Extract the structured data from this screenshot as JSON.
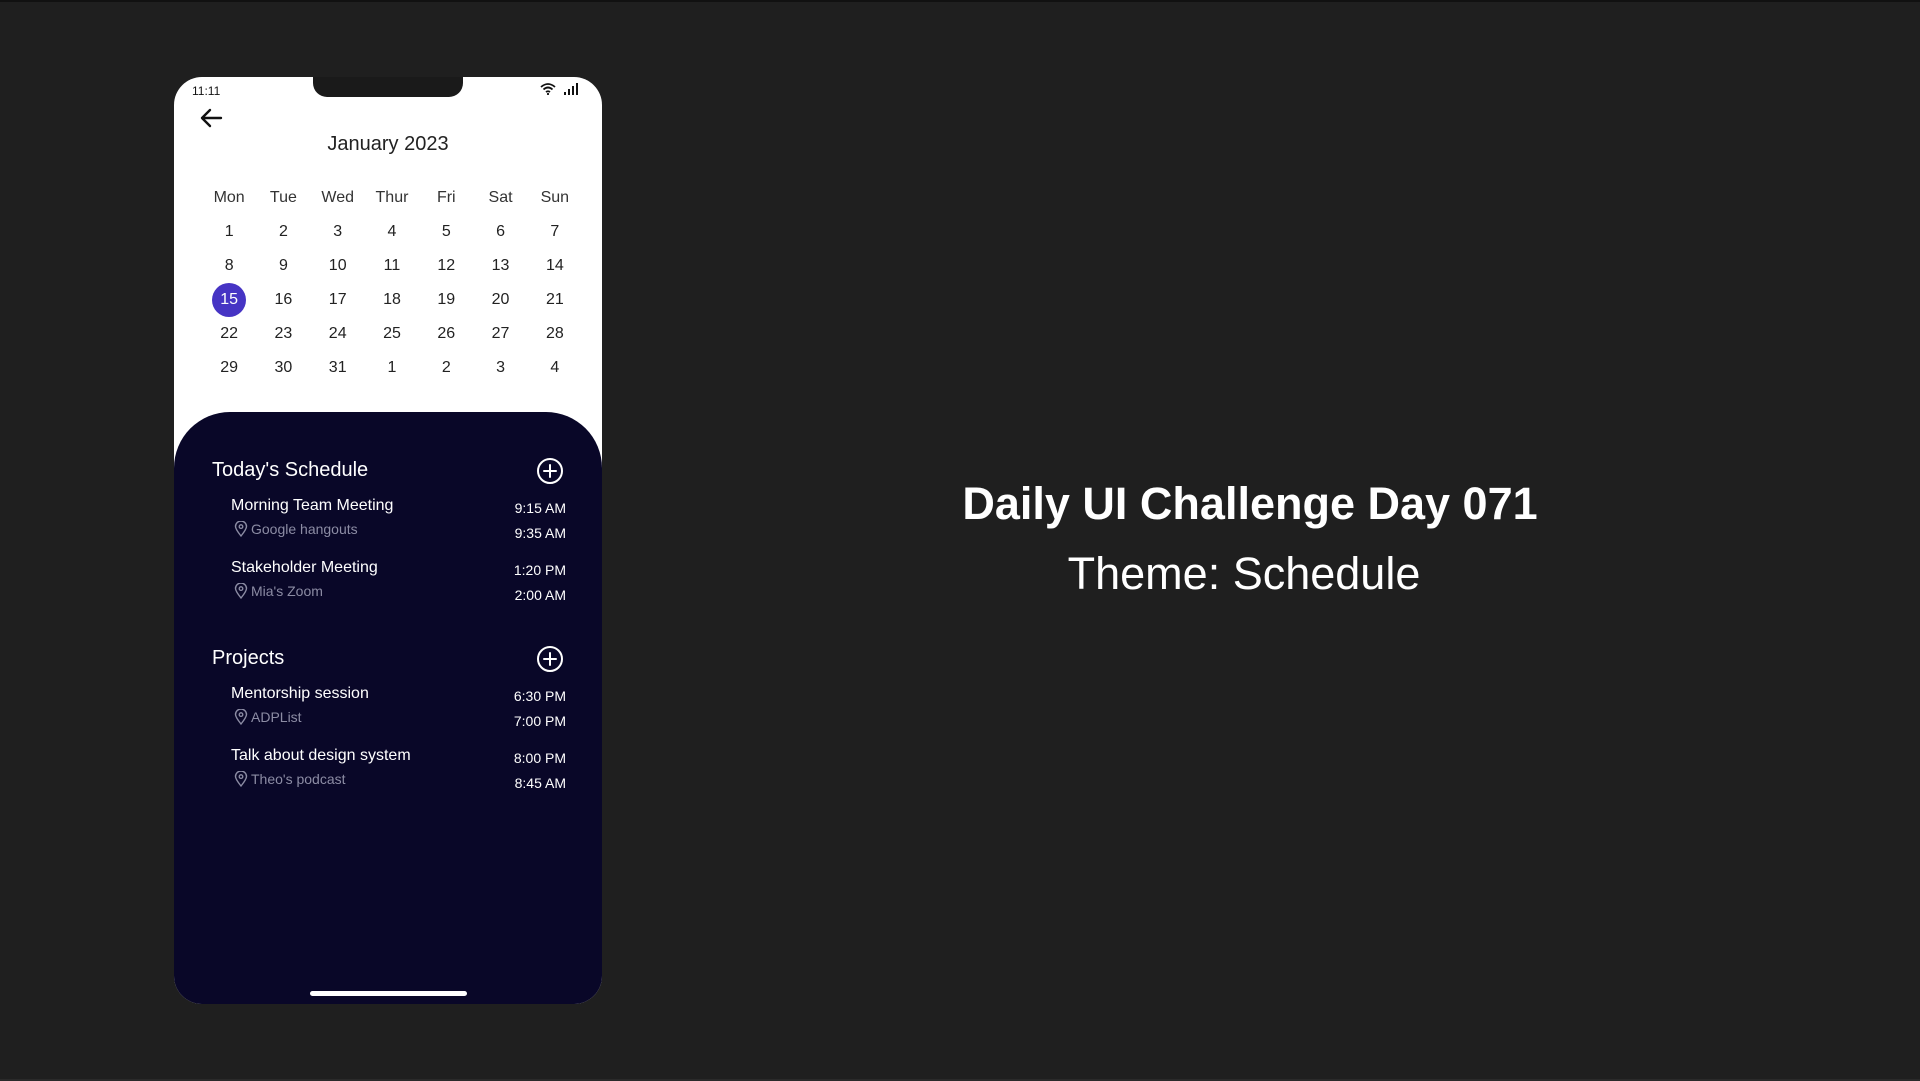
{
  "status_bar": {
    "time": "11:11"
  },
  "calendar": {
    "month_title": "January 2023",
    "weekdays": [
      "Mon",
      "Tue",
      "Wed",
      "Thur",
      "Fri",
      "Sat",
      "Sun"
    ],
    "days": [
      "1",
      "2",
      "3",
      "4",
      "5",
      "6",
      "7",
      "8",
      "9",
      "10",
      "11",
      "12",
      "13",
      "14",
      "15",
      "16",
      "17",
      "18",
      "19",
      "20",
      "21",
      "22",
      "23",
      "24",
      "25",
      "26",
      "27",
      "28",
      "29",
      "30",
      "31",
      "1",
      "2",
      "3",
      "4"
    ],
    "selected_day": "15",
    "accent_color": "#4634c4"
  },
  "today": {
    "title": "Today's Schedule",
    "events": [
      {
        "title": "Morning Team Meeting",
        "location": "Google hangouts",
        "start": "9:15 AM",
        "end": "9:35 AM"
      },
      {
        "title": "Stakeholder Meeting",
        "location": "Mia's Zoom",
        "start": "1:20 PM",
        "end": "2:00 AM"
      }
    ]
  },
  "projects": {
    "title": "Projects",
    "events": [
      {
        "title": "Mentorship session",
        "location": "ADPList",
        "start": "6:30 PM",
        "end": "7:00 PM"
      },
      {
        "title": "Talk about design system",
        "location": "Theo's podcast",
        "start": "8:00 PM",
        "end": "8:45 AM"
      }
    ]
  },
  "headline": {
    "title": "Daily UI Challenge Day 071",
    "subtitle": "Theme: Schedule"
  },
  "colors": {
    "background": "#1f1f1f",
    "panel": "#090728",
    "accent": "#4634c4"
  },
  "icons": {
    "back": "arrow-left-icon",
    "add": "plus-circle-icon",
    "location": "map-pin-icon",
    "wifi": "wifi-icon",
    "signal": "signal-icon"
  }
}
